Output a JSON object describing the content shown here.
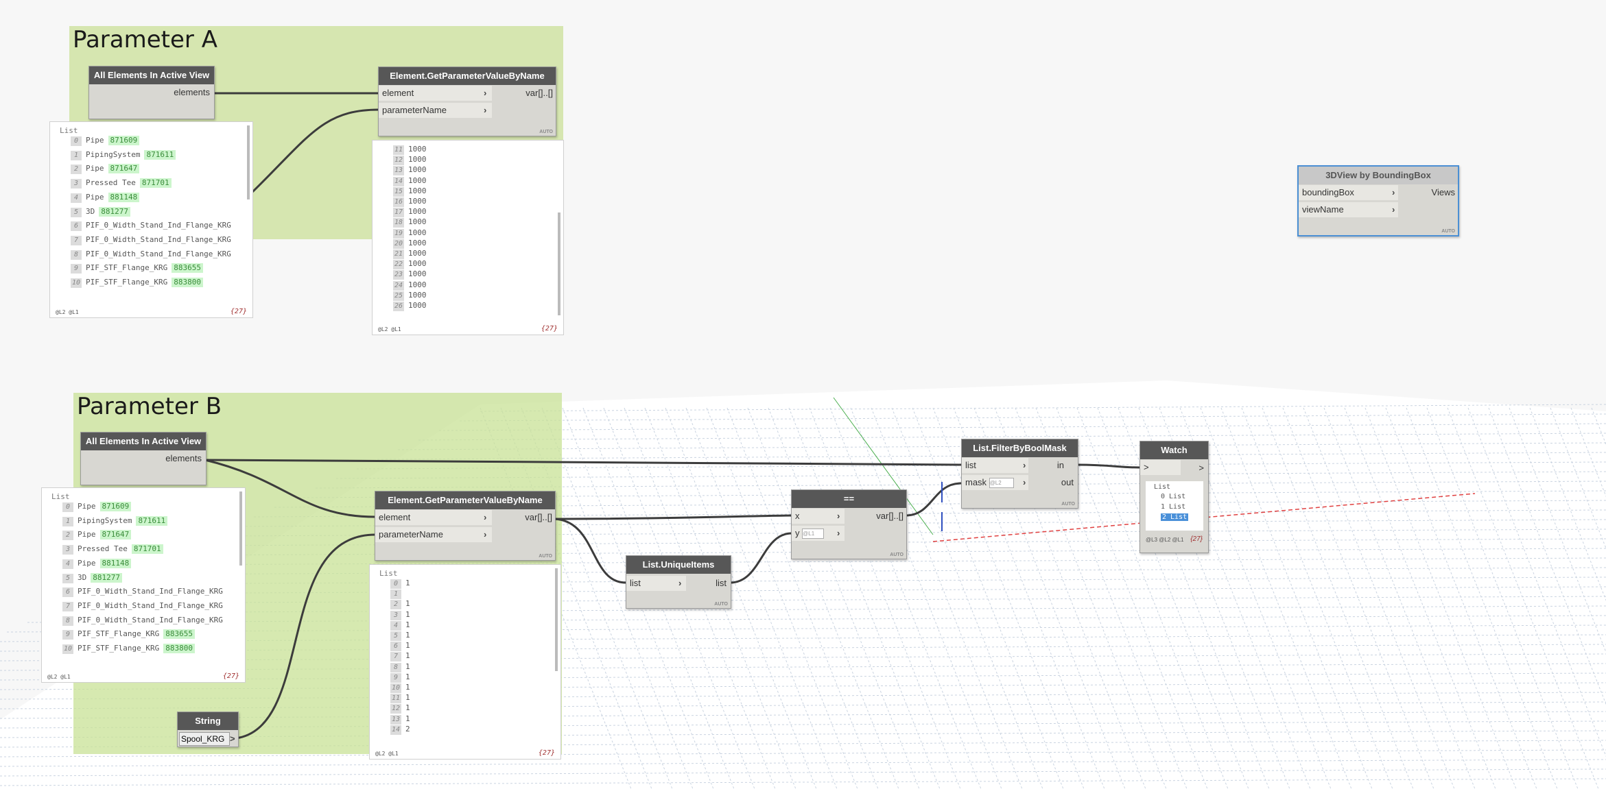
{
  "groups": {
    "a_title": "Parameter A",
    "b_title": "Parameter B",
    "color": "#d6e6b0"
  },
  "nodes": {
    "all_elements_label": "All Elements In Active View",
    "elements_port": "elements",
    "getparam_label": "Element.GetParameterValueByName",
    "element_port": "element",
    "parametername_port": "parameterName",
    "var_port": "var[]..[]",
    "auto": "AUTO",
    "bbox_label": "3DView by BoundingBox",
    "bbox_port": "boundingBox",
    "viewname_port": "viewName",
    "views_port": "Views",
    "unique_label": "List.UniqueItems",
    "list_port": "list",
    "eq_label": "==",
    "x_port": "x",
    "y_port": "y",
    "filter_label": "List.FilterByBoolMask",
    "mask_port": "mask",
    "in_port": "in",
    "out_port": "out",
    "watch_label": "Watch",
    "string_label": "String",
    "string_value": "Spool_KRG",
    "lacing_l2": "@L2",
    "lacing_l1": "@L1",
    "gt": ">"
  },
  "lists": {
    "list_title": "List",
    "levels": "@L2 @L1",
    "watch_levels": "@L3 @L2 @L1",
    "count": "{27}",
    "elements": [
      {
        "i": "0",
        "name": "Pipe",
        "id": "871609"
      },
      {
        "i": "1",
        "name": "PipingSystem",
        "id": "871611"
      },
      {
        "i": "2",
        "name": "Pipe",
        "id": "871647"
      },
      {
        "i": "3",
        "name": "Pressed Tee",
        "id": "871701"
      },
      {
        "i": "4",
        "name": "Pipe",
        "id": "881148"
      },
      {
        "i": "5",
        "name": "3D",
        "id": "881277"
      },
      {
        "i": "6",
        "name": "PIF_0_Width_Stand_Ind_Flange_KRG",
        "id": ""
      },
      {
        "i": "7",
        "name": "PIF_0_Width_Stand_Ind_Flange_KRG",
        "id": ""
      },
      {
        "i": "8",
        "name": "PIF_0_Width_Stand_Ind_Flange_KRG",
        "id": ""
      },
      {
        "i": "9",
        "name": "PIF_STF_Flange_KRG",
        "id": "883655"
      },
      {
        "i": "10",
        "name": "PIF_STF_Flange_KRG",
        "id": "883800"
      }
    ],
    "values_a": [
      {
        "i": "11",
        "v": "1000"
      },
      {
        "i": "12",
        "v": "1000"
      },
      {
        "i": "13",
        "v": "1000"
      },
      {
        "i": "14",
        "v": "1000"
      },
      {
        "i": "15",
        "v": "1000"
      },
      {
        "i": "16",
        "v": "1000"
      },
      {
        "i": "17",
        "v": "1000"
      },
      {
        "i": "18",
        "v": "1000"
      },
      {
        "i": "19",
        "v": "1000"
      },
      {
        "i": "20",
        "v": "1000"
      },
      {
        "i": "21",
        "v": "1000"
      },
      {
        "i": "22",
        "v": "1000"
      },
      {
        "i": "23",
        "v": "1000"
      },
      {
        "i": "24",
        "v": "1000"
      },
      {
        "i": "25",
        "v": "1000"
      },
      {
        "i": "26",
        "v": "1000"
      }
    ],
    "values_b": [
      {
        "i": "0",
        "v": "1"
      },
      {
        "i": "1",
        "v": ""
      },
      {
        "i": "2",
        "v": "1"
      },
      {
        "i": "3",
        "v": "1"
      },
      {
        "i": "4",
        "v": "1"
      },
      {
        "i": "5",
        "v": "1"
      },
      {
        "i": "6",
        "v": "1"
      },
      {
        "i": "7",
        "v": "1"
      },
      {
        "i": "8",
        "v": "1"
      },
      {
        "i": "9",
        "v": "1"
      },
      {
        "i": "10",
        "v": "1"
      },
      {
        "i": "11",
        "v": "1"
      },
      {
        "i": "12",
        "v": "1"
      },
      {
        "i": "13",
        "v": "1"
      },
      {
        "i": "14",
        "v": "2"
      }
    ],
    "watch_items": [
      "0 List",
      "1 List",
      "2 List"
    ]
  },
  "icons": [
    "chevron-right-icon",
    "spinner-icon"
  ]
}
